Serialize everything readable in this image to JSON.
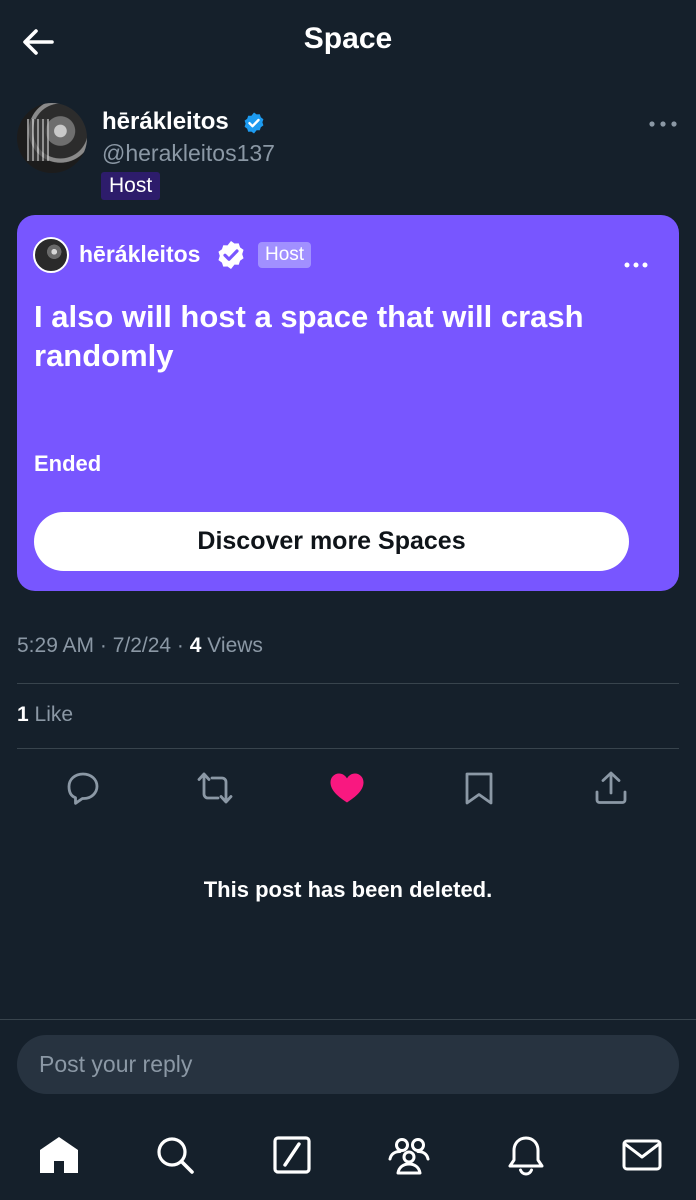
{
  "header": {
    "title": "Space"
  },
  "post": {
    "author_name": "hērákleitos",
    "author_handle": "@herakleitos137",
    "badge": "Host",
    "space": {
      "host_name": "hērákleitos",
      "host_badge": "Host",
      "title": "I also will host a space that will crash randomly",
      "status": "Ended",
      "discover_label": "Discover more Spaces",
      "card_color": "#7856ff"
    },
    "meta": {
      "time_date": "5:29 AM · 7/2/24 · ",
      "views_count": "4",
      "views_label": " Views"
    },
    "likes": {
      "count": "1",
      "label": " Like"
    },
    "deleted_notice": "This post has been deleted."
  },
  "actions": [
    {
      "name": "reply",
      "icon": "reply-icon"
    },
    {
      "name": "repost",
      "icon": "repost-icon"
    },
    {
      "name": "like",
      "icon": "heart-icon",
      "active": true,
      "color": "#f91880"
    },
    {
      "name": "bookmark",
      "icon": "bookmark-icon"
    },
    {
      "name": "share",
      "icon": "share-icon"
    }
  ],
  "reply": {
    "placeholder": "Post your reply"
  },
  "nav": [
    {
      "name": "home",
      "icon": "home-icon",
      "active": true
    },
    {
      "name": "search",
      "icon": "search-icon"
    },
    {
      "name": "grok",
      "icon": "grok-icon"
    },
    {
      "name": "communities",
      "icon": "communities-icon"
    },
    {
      "name": "notifications",
      "icon": "bell-icon"
    },
    {
      "name": "messages",
      "icon": "mail-icon"
    }
  ],
  "colors": {
    "background": "#15202b",
    "accent": "#1d9bf0",
    "like": "#f91880",
    "muted_text": "#8b98a5"
  }
}
